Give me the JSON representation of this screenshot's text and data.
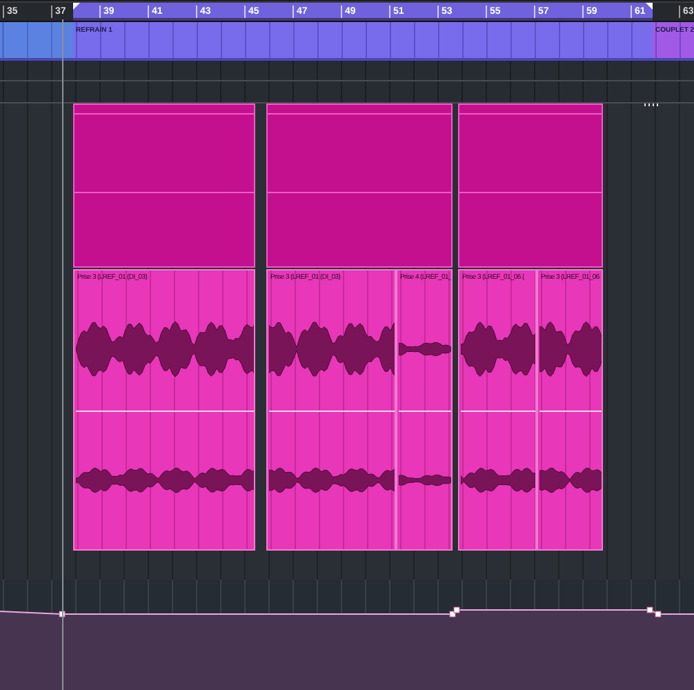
{
  "ruler": {
    "bars": [
      "35",
      "37",
      "39",
      "41",
      "43",
      "45",
      "47",
      "49",
      "51",
      "53",
      "55",
      "57",
      "59",
      "61",
      "63"
    ]
  },
  "markers": [
    {
      "label": "REFRAIN 1"
    },
    {
      "label": "COUPLET 2"
    }
  ],
  "events": [
    {
      "name": "Prise 3 (LREF_01 (DI_03)"
    },
    {
      "name": "Prise 3 (LREF_01 (DI_03)"
    },
    {
      "name": "Prise 4 (LREF_01_"
    },
    {
      "name": "Prise 3 (LREF_01_06 ("
    },
    {
      "name": "Prise 3 (LREF_01_06"
    }
  ]
}
